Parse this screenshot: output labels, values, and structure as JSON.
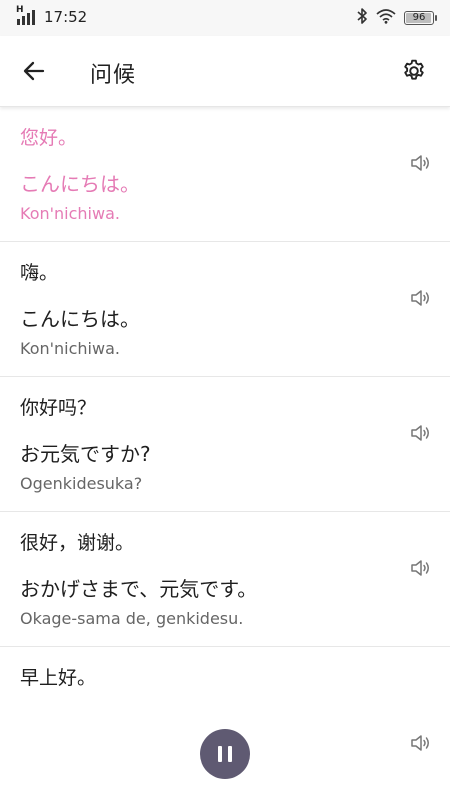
{
  "status_bar": {
    "signal_label": "H",
    "time": "17:52",
    "battery_pct": "96",
    "battery_level": 0.96
  },
  "header": {
    "title": "问候",
    "back_icon": "arrow-left-icon",
    "settings_icon": "gear-icon"
  },
  "phrases": [
    {
      "zh": "您好。",
      "ja": "こんにちは。",
      "romaji": "Kon'nichiwa.",
      "active": true
    },
    {
      "zh": "嗨。",
      "ja": "こんにちは。",
      "romaji": "Kon'nichiwa.",
      "active": false
    },
    {
      "zh": "你好吗？",
      "ja": "お元気ですか?",
      "romaji": "Ogenkidesuka?",
      "active": false
    },
    {
      "zh": "很好，谢谢。",
      "ja": "おかげさまで、元気です。",
      "romaji": "Okage-sama de, genkidesu.",
      "active": false
    },
    {
      "zh": "早上好。",
      "ja": "",
      "romaji": "",
      "active": false
    }
  ],
  "colors": {
    "active_text": "#e57bb5",
    "fab_background": "#5f5a72"
  },
  "player": {
    "state_icon": "pause-icon"
  }
}
